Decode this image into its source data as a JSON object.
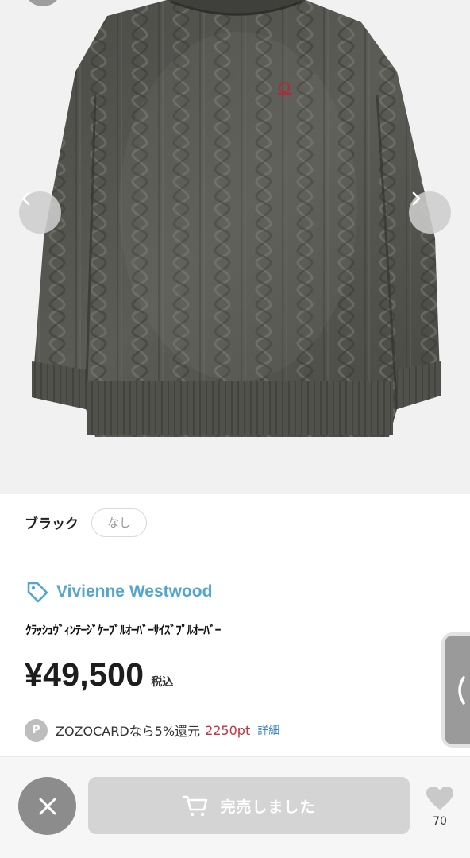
{
  "product": {
    "color_label": "ブラック",
    "stock_status": "なし",
    "brand_name": "Vivienne Westwood",
    "title": "ｸﾗｯｼｭｳﾞｨﾝﾃｰｼﾞｹｰﾌﾞﾙｵｰﾊﾞｰｻｲｽﾞﾌﾟﾙｵｰﾊﾞｰ",
    "price": "¥49,500",
    "tax_label": "税込"
  },
  "points": {
    "badge": "P",
    "text": "ZOZOCARDなら5%還元",
    "value": "2250pt",
    "detail_link": "詳細",
    "value_color": "#c3333f"
  },
  "actions": {
    "cart_label": "完売しました",
    "favorite_count": "70"
  },
  "icons": {
    "prev": "chevron-left-icon",
    "next": "chevron-right-icon",
    "brand": "tag-icon",
    "close": "close-icon",
    "cart": "cart-icon",
    "favorite": "heart-icon",
    "side": "chevron-left-icon"
  },
  "colors": {
    "brand_accent": "#52a6cf",
    "link": "#3d86c6",
    "button_disabled": "#d4d4d4"
  }
}
